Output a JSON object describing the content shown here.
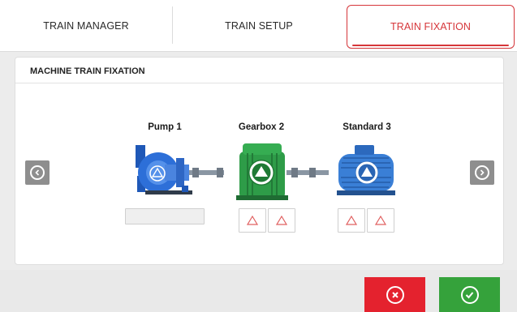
{
  "tabs": [
    {
      "label": "TRAIN MANAGER",
      "active": false
    },
    {
      "label": "TRAIN SETUP",
      "active": false
    },
    {
      "label": "TRAIN FIXATION",
      "active": true
    }
  ],
  "panel": {
    "title": "MACHINE TRAIN FIXATION"
  },
  "machines": [
    {
      "label": "Pump 1",
      "type": "pump",
      "color": "#2d6fd8"
    },
    {
      "label": "Gearbox 2",
      "type": "gearbox",
      "color": "#2e9c48"
    },
    {
      "label": "Standard 3",
      "type": "motor",
      "color": "#3a7fd6"
    }
  ],
  "icons": {
    "prev": "chevron-left-icon",
    "next": "chevron-right-icon",
    "warning": "warning-triangle-icon",
    "fixed_feet": "fixed-feet-triangle-icon",
    "cancel": "cancel-circle-icon",
    "confirm": "check-circle-icon"
  },
  "colors": {
    "accent": "#d6363a",
    "cancel": "#e4222e",
    "confirm": "#35a23b",
    "nav": "#8e8e8e"
  }
}
